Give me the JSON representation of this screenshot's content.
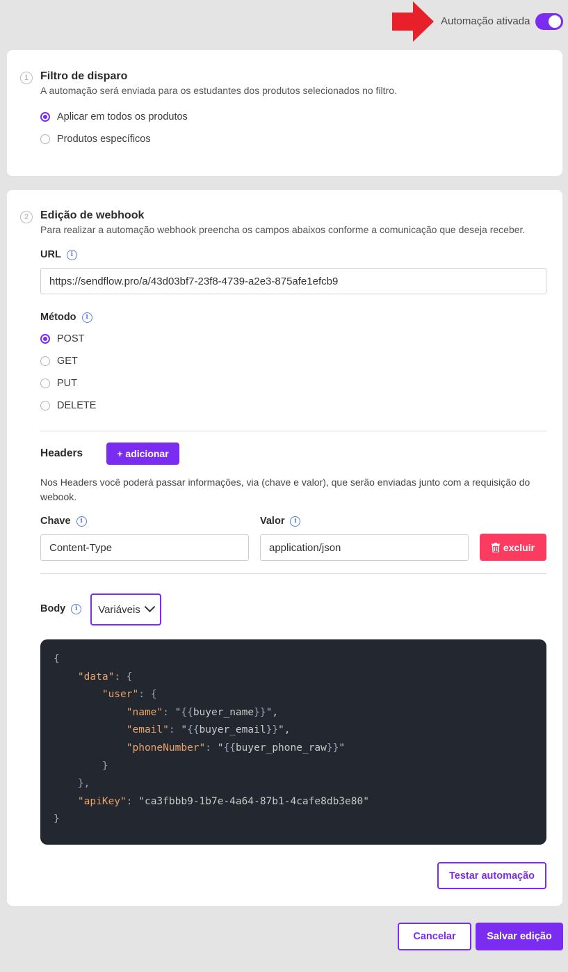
{
  "toggle": {
    "label": "Automação ativada",
    "on": true
  },
  "filter": {
    "step": "1",
    "title": "Filtro de disparo",
    "description": "A automação será enviada para os estudantes dos produtos selecionados no filtro.",
    "options": [
      {
        "label": "Aplicar em todos os produtos",
        "checked": true
      },
      {
        "label": "Produtos específicos",
        "checked": false
      }
    ]
  },
  "webhook": {
    "step": "2",
    "title": "Edição de webhook",
    "description": "Para realizar a automação webhook preencha os campos abaixos conforme a comunicação que deseja receber.",
    "url_label": "URL",
    "url_value": "https://sendflow.pro/a/43d03bf7-23f8-4739-a2e3-875afe1efcb9",
    "method_label": "Método",
    "methods": [
      {
        "label": "POST",
        "checked": true
      },
      {
        "label": "GET",
        "checked": false
      },
      {
        "label": "PUT",
        "checked": false
      },
      {
        "label": "DELETE",
        "checked": false
      }
    ],
    "headers_label": "Headers",
    "add_label": "+ adicionar",
    "headers_description": "Nos Headers você poderá passar informações, via (chave e valor), que serão enviadas junto com a requisição do webook.",
    "key_label": "Chave",
    "value_label": "Valor",
    "header_key": "Content-Type",
    "header_value": "application/json",
    "delete_label": "excluir",
    "body_label": "Body",
    "variables_label": "Variáveis",
    "body_lines": [
      "{",
      "    \"data\": {",
      "        \"user\": {",
      "            \"name\": \"{{buyer_name}}\",",
      "            \"email\": \"{{buyer_email}}\",",
      "            \"phoneNumber\": \"{{buyer_phone_raw}}\"",
      "        }",
      "    },",
      "    \"apiKey\": \"ca3fbbb9-1b7e-4a64-87b1-4cafe8db3e80\"",
      "}"
    ],
    "test_label": "Testar automação"
  },
  "footer": {
    "cancel_label": "Cancelar",
    "save_label": "Salvar edição"
  },
  "colors": {
    "accent": "#7a2cf0",
    "danger": "#fb3b5f",
    "arrow": "#e8202a",
    "code_bg": "#23272f"
  }
}
